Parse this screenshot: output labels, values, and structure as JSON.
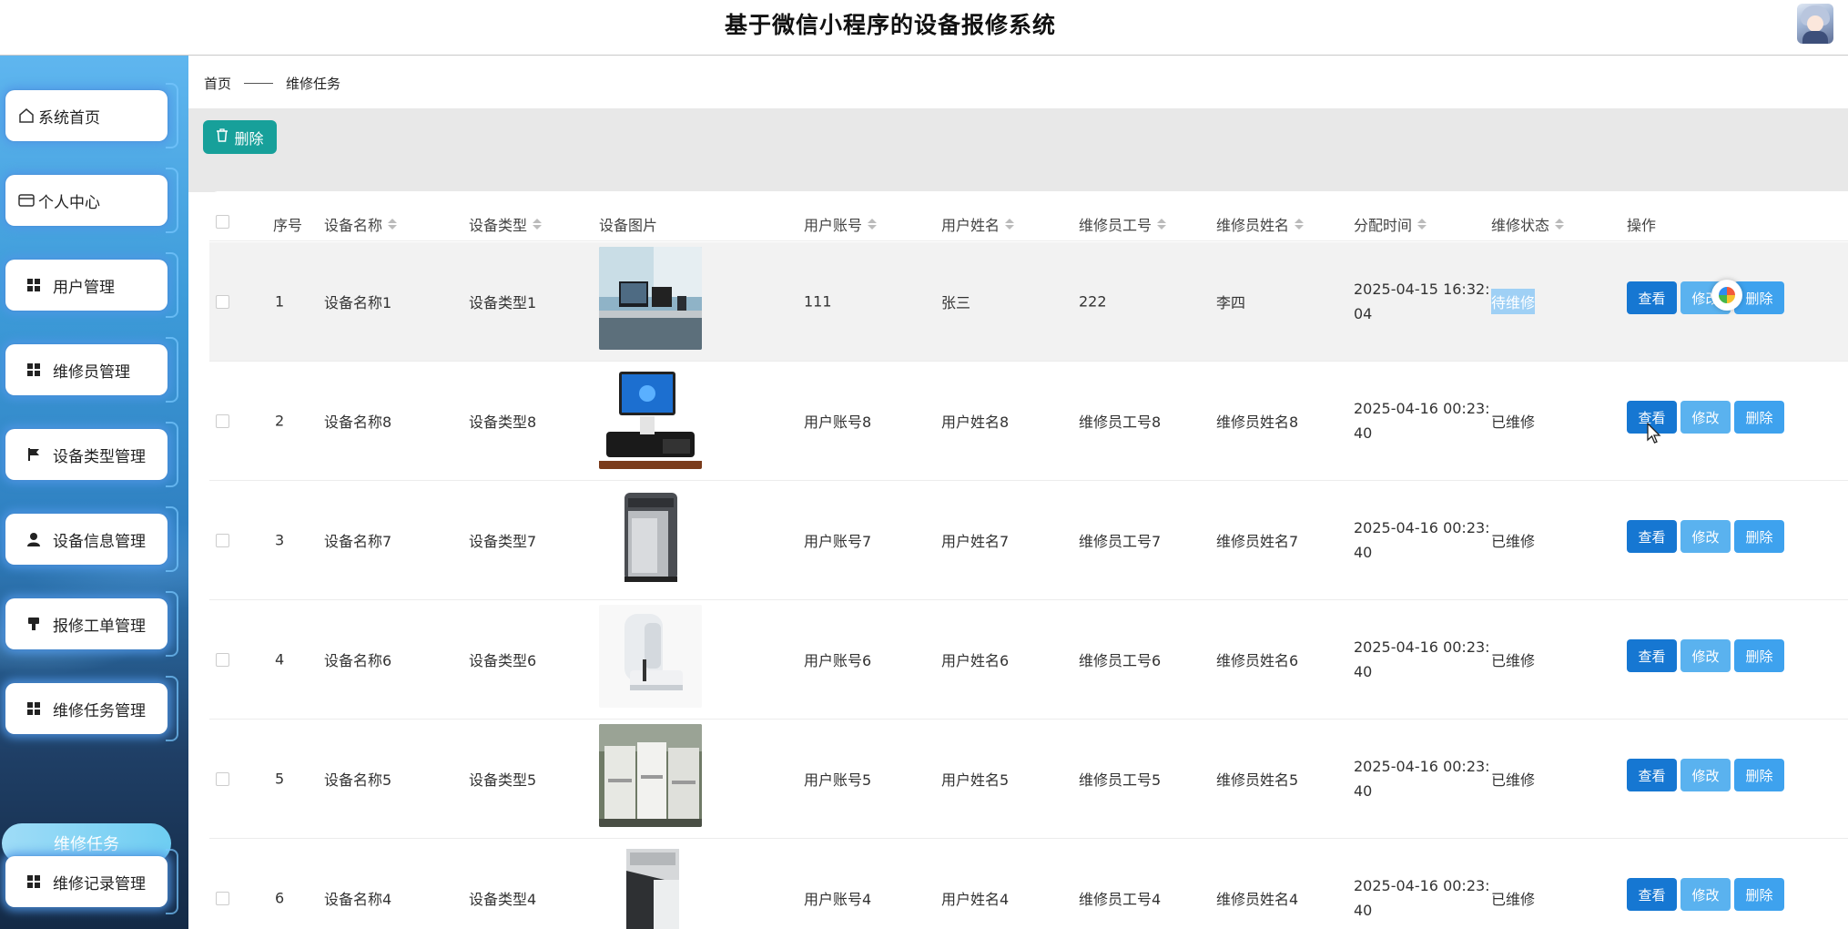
{
  "header": {
    "title": "基于微信小程序的设备报修系统"
  },
  "sidebar": {
    "items": [
      {
        "label": "系统首页",
        "icon": "home-icon"
      },
      {
        "label": "个人中心",
        "icon": "card-icon"
      },
      {
        "label": "用户管理",
        "icon": "grid-icon"
      },
      {
        "label": "维修员管理",
        "icon": "grid-icon"
      },
      {
        "label": "设备类型管理",
        "icon": "flag-icon"
      },
      {
        "label": "设备信息管理",
        "icon": "person-icon"
      },
      {
        "label": "报修工单管理",
        "icon": "tool-icon"
      },
      {
        "label": "维修任务管理",
        "icon": "grid-icon"
      },
      {
        "label": "维修记录管理",
        "icon": "grid-icon"
      }
    ],
    "active_sub": "维修任务"
  },
  "breadcrumb": {
    "home": "首页",
    "current": "维修任务"
  },
  "toolbar": {
    "delete_label": "删除"
  },
  "table": {
    "headers": {
      "index": "序号",
      "device_name": "设备名称",
      "device_type": "设备类型",
      "device_image": "设备图片",
      "user_account": "用户账号",
      "user_name": "用户姓名",
      "tech_id": "维修员工号",
      "tech_name": "维修员姓名",
      "assign_time": "分配时间",
      "status": "维修状态",
      "actions": "操作"
    },
    "actions": {
      "view": "查看",
      "edit": "修改",
      "delete": "删除"
    },
    "rows": [
      {
        "index": "1",
        "device_name": "设备名称1",
        "device_type": "设备类型1",
        "image": "office-desk-photo",
        "user_account": "111",
        "user_name": "张三",
        "tech_id": "222",
        "tech_name": "李四",
        "time1": "2025-04-15 16:32:",
        "time2": "04",
        "status": "待维修"
      },
      {
        "index": "2",
        "device_name": "设备名称8",
        "device_type": "设备类型8",
        "image": "pos-terminal-photo",
        "user_account": "用户账号8",
        "user_name": "用户姓名8",
        "tech_id": "维修员工号8",
        "tech_name": "维修员姓名8",
        "time1": "2025-04-16 00:23:",
        "time2": "40",
        "status": "已维修"
      },
      {
        "index": "3",
        "device_name": "设备名称7",
        "device_type": "设备类型7",
        "image": "shredder-photo",
        "user_account": "用户账号7",
        "user_name": "用户姓名7",
        "tech_id": "维修员工号7",
        "tech_name": "维修员姓名7",
        "time1": "2025-04-16 00:23:",
        "time2": "40",
        "status": "已维修"
      },
      {
        "index": "4",
        "device_name": "设备名称6",
        "device_type": "设备类型6",
        "image": "binding-machine-photo",
        "user_account": "用户账号6",
        "user_name": "用户姓名6",
        "tech_id": "维修员工号6",
        "tech_name": "维修员姓名6",
        "time1": "2025-04-16 00:23:",
        "time2": "40",
        "status": "已维修"
      },
      {
        "index": "5",
        "device_name": "设备名称5",
        "device_type": "设备类型5",
        "image": "copiers-photo",
        "user_account": "用户账号5",
        "user_name": "用户姓名5",
        "tech_id": "维修员工号5",
        "tech_name": "维修员姓名5",
        "time1": "2025-04-16 00:23:",
        "time2": "40",
        "status": "已维修"
      },
      {
        "index": "6",
        "device_name": "设备名称4",
        "device_type": "设备类型4",
        "image": "cabinet-photo",
        "user_account": "用户账号4",
        "user_name": "用户姓名4",
        "tech_id": "维修员工号4",
        "tech_name": "维修员姓名4",
        "time1": "2025-04-16 00:23:",
        "time2": "40",
        "status": "已维修"
      }
    ]
  },
  "colors": {
    "primary": "#1677d2",
    "edit": "#5ab2ef",
    "delete": "#3ea2ee",
    "teal": "#17a09a"
  }
}
